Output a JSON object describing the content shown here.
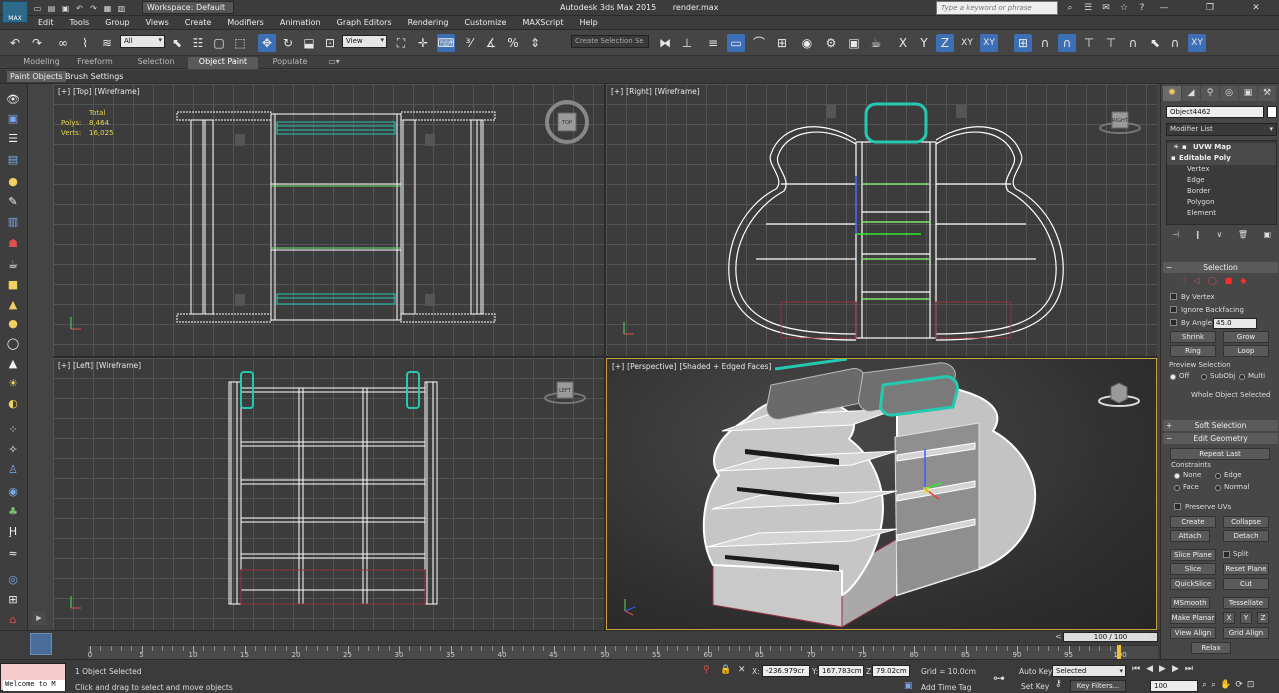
{
  "app": {
    "title": "Autodesk 3ds Max  2015",
    "file": "render.max",
    "logo": "MAX",
    "workspace": "Workspace: Default",
    "search_placeholder": "Type a keyword or phrase"
  },
  "menu": [
    "Edit",
    "Tools",
    "Group",
    "Views",
    "Create",
    "Modifiers",
    "Animation",
    "Graph Editors",
    "Rendering",
    "Customize",
    "MAXScript",
    "Help"
  ],
  "toolbar": {
    "filter_value": "All",
    "ref_coord_value": "View",
    "selection_set_placeholder": "Create Selection Se",
    "constraint_labels": [
      "X",
      "Y",
      "Z",
      "XY",
      "XY"
    ]
  },
  "ribbon": {
    "tabs": [
      "Modeling",
      "Freeform",
      "Selection",
      "Object Paint",
      "Populate"
    ],
    "active_tab": "Object Paint",
    "subtabs": [
      "Paint Objects",
      "Brush Settings"
    ]
  },
  "viewports": {
    "top": {
      "label": [
        "[+]",
        "[Top]",
        "[Wireframe]"
      ]
    },
    "right": {
      "label": [
        "[+]",
        "[Right]",
        "[Wireframe]"
      ]
    },
    "left": {
      "label": [
        "[+]",
        "[Left]",
        "[Wireframe]"
      ]
    },
    "perspective": {
      "label": [
        "[+]",
        "[Perspective]",
        "[Shaded + Edged Faces]"
      ]
    },
    "stats": {
      "total_label": "Total",
      "polys_label": "Polys:",
      "polys_value": "8,464",
      "verts_label": "Verts:",
      "verts_value": "16,025"
    },
    "viewcube_labels": {
      "top": "TOP",
      "right": "RIGHT",
      "left": "LEFT"
    }
  },
  "command_panel": {
    "object_name": "Object4462",
    "modifier_list": "Modifier List",
    "stack": {
      "uvw_map": "UVW Map",
      "editable_poly": "Editable Poly",
      "sub_objects": [
        "Vertex",
        "Edge",
        "Border",
        "Polygon",
        "Element"
      ]
    },
    "selection": {
      "title": "Selection",
      "by_vertex": "By Vertex",
      "ignore_backfacing": "Ignore Backfacing",
      "by_angle": "By Angle:",
      "angle_value": "45.0",
      "shrink": "Shrink",
      "grow": "Grow",
      "ring": "Ring",
      "loop": "Loop",
      "preview_title": "Preview Selection",
      "preview_options": [
        "Off",
        "SubObj",
        "Multi"
      ],
      "status": "Whole Object Selected"
    },
    "soft_selection": "Soft Selection",
    "edit_geometry": {
      "title": "Edit Geometry",
      "repeat_last": "Repeat Last",
      "constraints_title": "Constraints",
      "constraints": [
        "None",
        "Edge",
        "Face",
        "Normal"
      ],
      "preserve_uvs": "Preserve UVs",
      "create": "Create",
      "collapse": "Collapse",
      "attach": "Attach",
      "detach": "Detach",
      "slice_plane": "Slice Plane",
      "split": "Split",
      "slice": "Slice",
      "reset_plane": "Reset Plane",
      "quickslice": "QuickSlice",
      "cut": "Cut",
      "msmooth": "MSmooth",
      "tessellate": "Tessellate",
      "make_planar": "Make Planar",
      "x": "X",
      "y": "Y",
      "z": "Z",
      "view_align": "View Align",
      "grid_align": "Grid Align",
      "relax": "Relax"
    }
  },
  "timeline": {
    "slider_label": "100 / 100",
    "ticks": [
      "0",
      "5",
      "10",
      "15",
      "20",
      "25",
      "30",
      "35",
      "40",
      "45",
      "50",
      "55",
      "60",
      "65",
      "70",
      "75",
      "80",
      "85",
      "90",
      "95",
      "100"
    ]
  },
  "status": {
    "maxscript_text": "Welcome to M",
    "selected_text": "1 Object Selected",
    "prompt_text": "Click and drag to select and move objects",
    "x_label": "X:",
    "x_value": "-236.979cr",
    "y_label": "Y:",
    "y_value": "167.783cm",
    "z_label": "Z:",
    "z_value": "79.02cm",
    "grid": "Grid = 10.0cm",
    "add_time_tag": "Add Time Tag",
    "auto_key": "Auto Key",
    "set_key": "Set Key",
    "selected_dropdown": "Selected",
    "key_filters": "Key Filters...",
    "frame_value": "100"
  }
}
